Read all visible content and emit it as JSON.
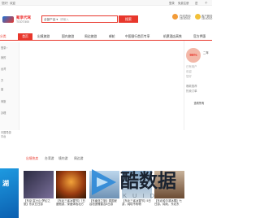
{
  "topbar": {
    "left_text": "您好！欢迎",
    "right_links": [
      "登录",
      "免费注册",
      "进",
      "个"
    ]
  },
  "header": {
    "logo_title": "聚享代驾",
    "logo_sub": "TOOT.500",
    "search_category": "全部产品 ▾",
    "search_placeholder": "请输入",
    "search_button": "搜索",
    "service_1": "在线咨询",
    "service_1_sub": "18:00:00",
    "service_2": "客户服务",
    "service_2_sub": "18:00:00"
  },
  "nav": {
    "category_label": "分类",
    "items": [
      "首页",
      "出境旅游",
      "国内旅游",
      "周边旅游",
      "邮轮",
      "中国银行首页专享",
      "机票酒店高铁",
      "官方押惠"
    ]
  },
  "sidebar": {
    "items": [
      "登录 ›",
      "我的",
      "台湾",
      "方",
      "度",
      "商旅",
      "办理",
      "中国导游",
      "平台"
    ]
  },
  "panel": {
    "percent": "96%",
    "label": "二年",
    "lines": [
      "已有用户",
      "欢迎",
      "您好",
      "爆款推荐",
      "热卖订单"
    ],
    "button": "查看所有"
  },
  "tabs": [
    "出境热卖",
    "台湾游",
    "境内游",
    "周边游"
  ],
  "cards": [
    {
      "caption": "【东京·富士山·梦幻之旅】东京五日游"
    },
    {
      "caption": "【东北三省冰雪节】7日度假游，深度体验北方"
    },
    {
      "caption": "【东南亚之旅】泰国曼谷芭提雅普吉6日游"
    },
    {
      "caption": "【东北三省冰雪节】5日游，纯玩不购物"
    },
    {
      "caption": "【东北哈尔滨冰雪】七日游，纯玩，东北东"
    }
  ],
  "watermark": {
    "cn": "酷数据",
    "en": "KUID"
  }
}
